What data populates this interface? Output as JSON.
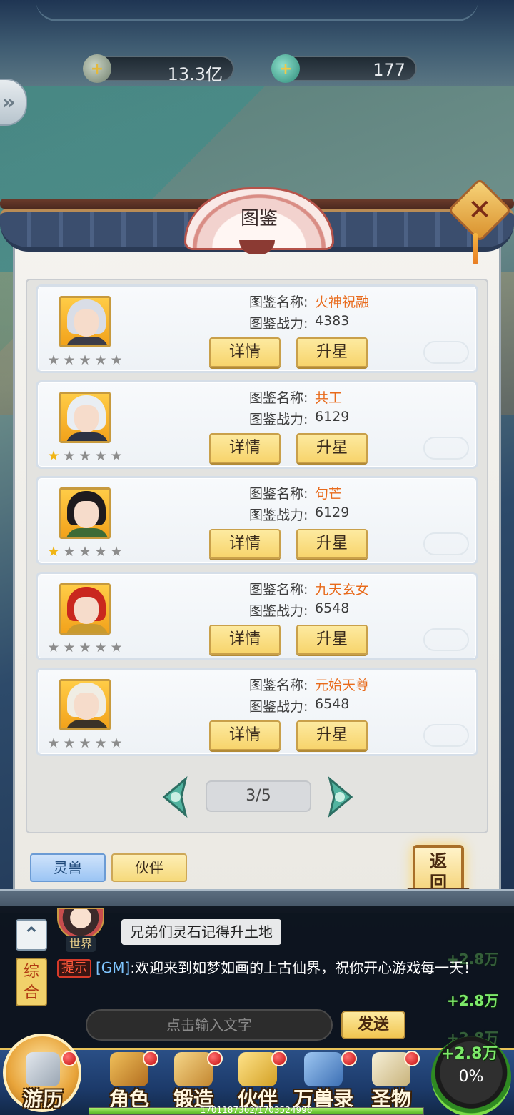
{
  "resources": {
    "spirit_stone": "13.3亿",
    "jade": "177"
  },
  "panel": {
    "title": "图鉴",
    "name_label": "图鉴名称:",
    "power_label": "图鉴战力:",
    "detail_label": "详情",
    "upgrade_label": "升星",
    "cards": [
      {
        "name": "火神祝融",
        "power": "4383",
        "stars_lit": 0,
        "stars_total": 5
      },
      {
        "name": "共工",
        "power": "6129",
        "stars_lit": 1,
        "stars_total": 5
      },
      {
        "name": "句芒",
        "power": "6129",
        "stars_lit": 1,
        "stars_total": 5
      },
      {
        "name": "九天玄女",
        "power": "6548",
        "stars_lit": 0,
        "stars_total": 5
      },
      {
        "name": "元始天尊",
        "power": "6548",
        "stars_lit": 0,
        "stars_total": 5
      }
    ],
    "pager": "3/5",
    "tabs": [
      "灵兽",
      "伙伴"
    ],
    "back_label": "返\n回"
  },
  "chat": {
    "world_tag": "世界",
    "world_message": "兄弟们灵石记得升土地",
    "channel_label": "综合",
    "tip_badge": "提示",
    "gm_prefix": "[GM]",
    "gm_message": ":欢迎来到如梦如画的上古仙界，祝你开心游戏每一天！",
    "input_placeholder": "点击输入文字",
    "send_label": "发送",
    "gains": [
      "+2.8万",
      "+2.8万",
      "+2.8万"
    ]
  },
  "nav": {
    "items": [
      "游历",
      "角色",
      "锻造",
      "伙伴",
      "万兽录",
      "圣物"
    ],
    "orb_gain": "+2.8万",
    "orb_percent": "0%",
    "xp_text": "1701187362/1703524996"
  },
  "colors": {
    "accent_orange": "#e86a1b",
    "star_on": "#f0b515",
    "gain_green": "#7dea6a",
    "gm_blue": "#7fc6ff"
  }
}
